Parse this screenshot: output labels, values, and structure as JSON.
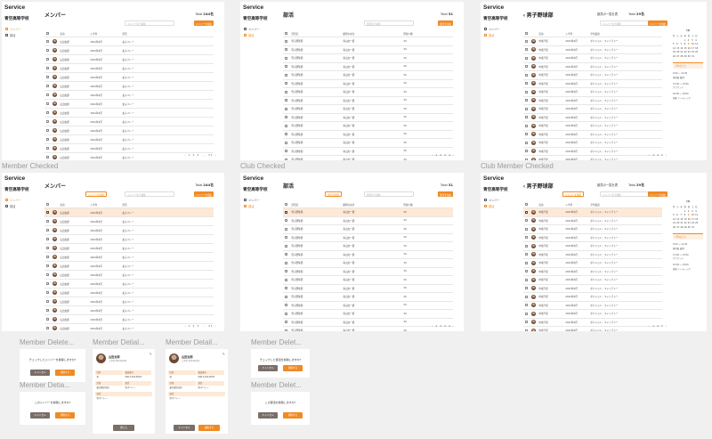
{
  "labels": {
    "member_checked": "Member Checked",
    "club_checked": "Club Checked",
    "club_member_checked": "Club Member Checked",
    "member_delete_1": "Member Delete...",
    "member_detail_1": "Member Detial...",
    "member_detail_2": "Member Detail...",
    "member_delete_2": "Member Delet...",
    "member_detail_3": "Member Detia...",
    "member_delete_3": "Member Delet..."
  },
  "app": {
    "title": "Service",
    "school": "青空高等学校"
  },
  "nav": [
    {
      "label": "メンバー"
    },
    {
      "label": "部活"
    }
  ],
  "member_screen": {
    "heading": "メンバー",
    "total_label": "Total",
    "total_value": "244名",
    "search_placeholder": "メンバー名で検索",
    "add_button": "メンバーを追加",
    "delete_button": "メンバーを削除",
    "columns": [
      "名前",
      "入学年",
      "部活"
    ],
    "rows": [
      {
        "name": "山田太郎",
        "year": "2021年4月",
        "club": "女子バレー"
      },
      {
        "name": "山田太郎",
        "year": "2021年4月",
        "club": "女子バレー"
      },
      {
        "name": "山田太郎",
        "year": "2021年4月",
        "club": "女子バレー"
      },
      {
        "name": "山田太郎",
        "year": "2021年4月",
        "club": "女子バレー"
      },
      {
        "name": "山田太郎",
        "year": "2021年4月",
        "club": "女子バレー"
      },
      {
        "name": "山田太郎",
        "year": "2021年4月",
        "club": "女子バレー"
      },
      {
        "name": "山田太郎",
        "year": "2021年4月",
        "club": "女子バレー"
      },
      {
        "name": "山田太郎",
        "year": "2021年4月",
        "club": "女子バレー"
      },
      {
        "name": "山田太郎",
        "year": "2021年4月",
        "club": "女子バレー"
      },
      {
        "name": "山田太郎",
        "year": "2021年4月",
        "club": "女子バレー"
      },
      {
        "name": "山田太郎",
        "year": "2021年4月",
        "club": "女子バレー"
      },
      {
        "name": "山田太郎",
        "year": "2021年4月",
        "club": "女子バレー"
      },
      {
        "name": "山田太郎",
        "year": "2021年4月",
        "club": "女子バレー"
      },
      {
        "name": "山田太郎",
        "year": "2021年4月",
        "club": "女子バレー"
      },
      {
        "name": "山田太郎",
        "year": "2021年4月",
        "club": "女子バレー"
      }
    ],
    "pager": "‹ 1 2 3 ... 31 ›"
  },
  "club_screen": {
    "heading": "部活",
    "total_label": "Total",
    "total_value": "31",
    "search_placeholder": "部活名で検索",
    "add_button": "部活を追加",
    "delete_button": "部活を削除",
    "columns": [
      "部活名",
      "顧問の先生",
      "所属人数"
    ],
    "rows": [
      {
        "name": "男子野球部",
        "teacher": "青山太一郎",
        "count": "34"
      },
      {
        "name": "男子野球部",
        "teacher": "青山太一郎",
        "count": "34"
      },
      {
        "name": "男子野球部",
        "teacher": "青山太一郎",
        "count": "34"
      },
      {
        "name": "男子野球部",
        "teacher": "青山太一郎",
        "count": "34"
      },
      {
        "name": "男子野球部",
        "teacher": "青山太一郎",
        "count": "34"
      },
      {
        "name": "男子野球部",
        "teacher": "青山太一郎",
        "count": "34"
      },
      {
        "name": "男子野球部",
        "teacher": "青山太一郎",
        "count": "34"
      },
      {
        "name": "男子野球部",
        "teacher": "青山太一郎",
        "count": "34"
      },
      {
        "name": "男子野球部",
        "teacher": "青山太一郎",
        "count": "34"
      },
      {
        "name": "男子野球部",
        "teacher": "青山太一郎",
        "count": "34"
      },
      {
        "name": "男子野球部",
        "teacher": "青山太一郎",
        "count": "34"
      },
      {
        "name": "男子野球部",
        "teacher": "青山太一郎",
        "count": "34"
      },
      {
        "name": "男子野球部",
        "teacher": "青山太一郎",
        "count": "34"
      },
      {
        "name": "男子野球部",
        "teacher": "青山太一郎",
        "count": "34"
      },
      {
        "name": "男子野球部",
        "teacher": "青山太一郎",
        "count": "34"
      }
    ],
    "pager": "‹ 1 2 3 4 ›"
  },
  "club_member_screen": {
    "heading": "‹ 男子野球部",
    "sub_label": "部員の一覧を表",
    "total_label": "Total",
    "total_value": "29名",
    "search_placeholder": "メンバー名で検索",
    "add_button": "メンバーを追加",
    "delete_button": "メンバーを削除",
    "top_buttons": [
      "活動日時を追加",
      "部活を編集"
    ],
    "columns": [
      "名前",
      "入学年",
      "学位役割"
    ],
    "rows": [
      {
        "name": "中坂千紀",
        "year": "2021年4月",
        "role": "ポジション：キャッチャー"
      },
      {
        "name": "中坂千紀",
        "year": "2021年4月",
        "role": "ポジション：キャッチャー"
      },
      {
        "name": "中坂千紀",
        "year": "2021年4月",
        "role": "ポジション：キャッチャー"
      },
      {
        "name": "中坂千紀",
        "year": "2021年4月",
        "role": "ポジション：キャッチャー"
      },
      {
        "name": "中坂千紀",
        "year": "2021年4月",
        "role": "ポジション：キャッチャー"
      },
      {
        "name": "中坂千紀",
        "year": "2021年4月",
        "role": "ポジション：キャッチャー"
      },
      {
        "name": "中坂千紀",
        "year": "2021年4月",
        "role": "ポジション：キャッチャー"
      },
      {
        "name": "中坂千紀",
        "year": "2021年4月",
        "role": "ポジション：キャッチャー"
      },
      {
        "name": "中坂千紀",
        "year": "2021年4月",
        "role": "ポジション：キャッチャー"
      },
      {
        "name": "中坂千紀",
        "year": "2021年4月",
        "role": "ポジション：キャッチャー"
      },
      {
        "name": "中坂千紀",
        "year": "2021年4月",
        "role": "ポジション：キャッチャー"
      },
      {
        "name": "中坂千紀",
        "year": "2021年4月",
        "role": "ポジション：キャッチャー"
      },
      {
        "name": "中坂千紀",
        "year": "2021年4月",
        "role": "ポジション：キャッチャー"
      },
      {
        "name": "中坂千紀",
        "year": "2021年4月",
        "role": "ポジション：キャッチャー"
      },
      {
        "name": "中坂千紀",
        "year": "2021年4月",
        "role": "ポジション：キャッチャー"
      }
    ],
    "calendar": {
      "month": "7月",
      "weekdays": [
        "月",
        "火",
        "水",
        "木",
        "金",
        "土",
        "日"
      ],
      "days": [
        "",
        "",
        "",
        "1",
        "2",
        "3",
        "4",
        "5",
        "6",
        "7",
        "8",
        "9",
        "10",
        "11",
        "12",
        "13",
        "14",
        "15",
        "16",
        "17",
        "18",
        "19",
        "20",
        "21",
        "22",
        "23",
        "24",
        "25",
        "26",
        "27",
        "28",
        "29",
        "30",
        "31",
        "",
        ""
      ],
      "selected_heading": "7月9日(土)",
      "events": [
        "9:00 ～ 11:00",
        "体育館 練習",
        "13:00 ～ 15:00",
        "グラウンド",
        "16:00 ～ 18:00",
        "部室 ミーティング"
      ]
    },
    "pager": "‹ 1 2 3 ›"
  },
  "dialogs": {
    "member_delete_msg": "チェックしたメンバーを削除しますか?",
    "member_delete_single_msg": "このメンバーを削除しますか?",
    "club_delete_msg": "チェックした部活を削除しますか?",
    "club_delete_single_msg": "この部活を削除しますか?",
    "cancel": "キャンセル",
    "delete": "削除する",
    "close": "閉じる",
    "edit": "編集する"
  },
  "detail": {
    "name": "山田太郎",
    "sub": "入学年 2021年4月",
    "fields": [
      {
        "label": "性別",
        "value": "男"
      },
      {
        "label": "電話番号",
        "value": "090-1234-5678"
      },
      {
        "label": "住所",
        "value": "東京都渋谷区"
      },
      {
        "label": "部活",
        "value": "男子バレー"
      }
    ]
  }
}
